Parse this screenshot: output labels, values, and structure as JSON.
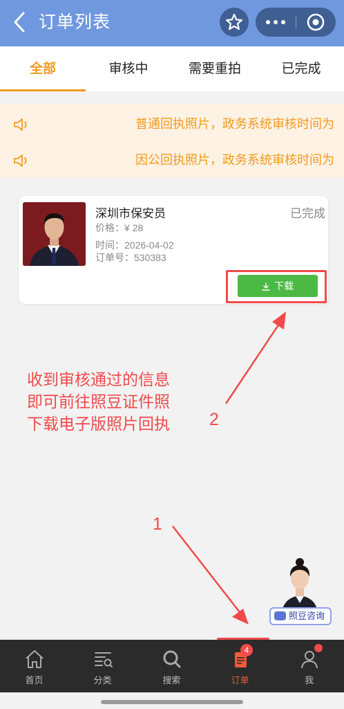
{
  "header": {
    "title": "订单列表",
    "back_icon": "chevron-left-icon",
    "star_icon": "star-icon",
    "more_icon": "more-dots-icon",
    "close_icon": "target-icon"
  },
  "tabs": [
    {
      "label": "全部",
      "active": true
    },
    {
      "label": "审核中",
      "active": false
    },
    {
      "label": "需要重拍",
      "active": false
    },
    {
      "label": "已完成",
      "active": false
    }
  ],
  "notices": [
    {
      "icon": "speaker-icon",
      "text": "普通回执照片，政务系统审核时间为"
    },
    {
      "icon": "speaker-icon",
      "text": "因公回执照片，政务系统审核时间为"
    }
  ],
  "order": {
    "name": "深圳市保安员",
    "status": "已完成",
    "price_label": "价格：",
    "price_value": "¥ 28",
    "time_label": "时间：",
    "time_value": "2026-04-02",
    "order_no_label": "订单号：",
    "order_no_value": "530383",
    "download_label": "下载",
    "download_icon": "download-icon"
  },
  "annotations": {
    "note_lines": [
      "收到审核通过的信息",
      "即可前往照豆证件照",
      "下载电子版照片回执"
    ],
    "step_1": "1",
    "step_2": "2"
  },
  "consult": {
    "label": "照豆咨询"
  },
  "tabbar": [
    {
      "label": "首页",
      "icon": "home-icon"
    },
    {
      "label": "分类",
      "icon": "category-icon"
    },
    {
      "label": "搜索",
      "icon": "search-icon"
    },
    {
      "label": "订单",
      "icon": "order-icon",
      "badge": "4",
      "active": true
    },
    {
      "label": "我",
      "icon": "user-icon"
    }
  ],
  "colors": {
    "header_bg": "#6f98df",
    "accent": "#f39a1e",
    "download_green": "#4cb944",
    "annotation_red": "#f04a4a",
    "tabbar_bg": "#2b2b2b"
  }
}
